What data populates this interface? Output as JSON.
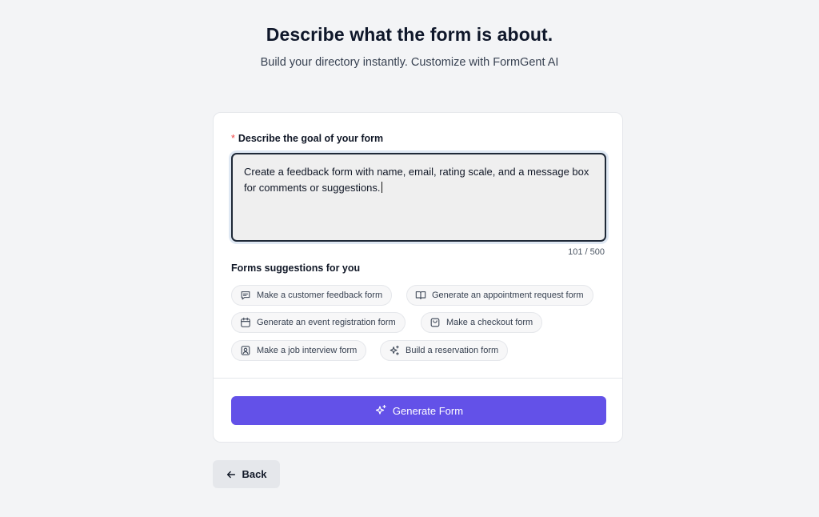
{
  "header": {
    "title": "Describe what the form is about.",
    "subtitle": "Build your directory instantly. Customize with FormGent AI"
  },
  "form": {
    "required_mark": "*",
    "goal_label": "Describe the goal of your form",
    "prompt_value": "Create a feedback form with name, email, rating scale, and a message box for comments or suggestions.",
    "char_count": "101 / 500"
  },
  "suggestions": {
    "heading": "Forms suggestions for you",
    "items": [
      {
        "label": "Make a customer feedback form",
        "icon": "chat-icon"
      },
      {
        "label": "Generate an appointment request form",
        "icon": "book-open-icon"
      },
      {
        "label": "Generate an event registration form",
        "icon": "calendar-icon"
      },
      {
        "label": "Make a checkout form",
        "icon": "shopping-bag-icon"
      },
      {
        "label": "Make a job interview form",
        "icon": "id-badge-icon"
      },
      {
        "label": "Build a reservation form",
        "icon": "sparkles-icon"
      }
    ]
  },
  "actions": {
    "generate_label": "Generate Form",
    "back_label": "Back"
  },
  "colors": {
    "accent": "#6351e8",
    "required": "#ef4444",
    "background": "#f3f4f6"
  }
}
